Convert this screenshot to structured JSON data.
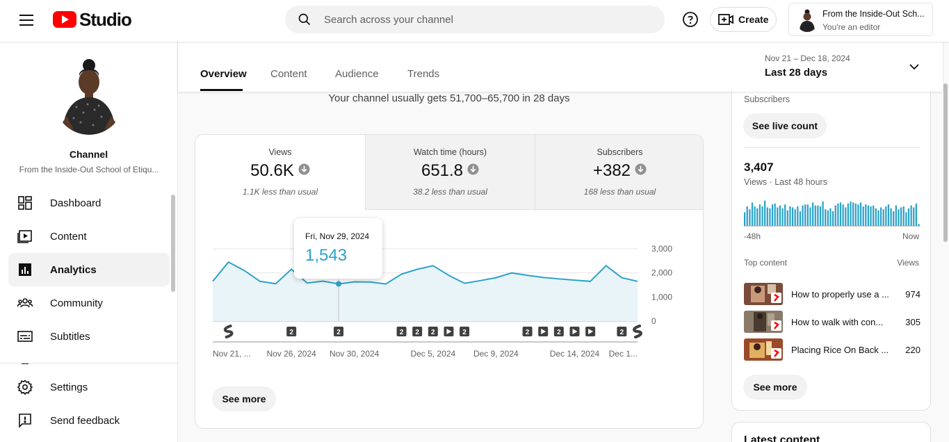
{
  "topbar": {
    "logo_text": "Studio",
    "search_placeholder": "Search across your channel",
    "create_label": "Create",
    "account_name": "From the Inside-Out Sch...",
    "account_role": "You're an editor"
  },
  "sidebar": {
    "channel_label": "Channel",
    "channel_name": "From the Inside-Out School of Etiqu...",
    "items": [
      {
        "label": "Dashboard",
        "icon": "dashboard-icon"
      },
      {
        "label": "Content",
        "icon": "content-icon"
      },
      {
        "label": "Analytics",
        "icon": "analytics-icon"
      },
      {
        "label": "Community",
        "icon": "community-icon"
      },
      {
        "label": "Subtitles",
        "icon": "subtitles-icon"
      }
    ],
    "bottom_items": [
      {
        "label": "Settings",
        "icon": "gear-icon"
      },
      {
        "label": "Send feedback",
        "icon": "feedback-icon"
      }
    ]
  },
  "tabs": [
    "Overview",
    "Content",
    "Audience",
    "Trends"
  ],
  "date_range": {
    "dates": "Nov 21 – Dec 18, 2024",
    "label": "Last 28 days"
  },
  "usual_text": "Your channel usually gets 51,700–65,700 in 28 days",
  "metrics": [
    {
      "label": "Views",
      "value": "50.6K",
      "comparison": "1.1K less than usual"
    },
    {
      "label": "Watch time (hours)",
      "value": "651.8",
      "comparison": "38.2 less than usual"
    },
    {
      "label": "Subscribers",
      "value": "+382",
      "comparison": "168 less than usual"
    }
  ],
  "chart_data": {
    "type": "area",
    "series_name": "Views",
    "x": [
      "Nov 21",
      "Nov 22",
      "Nov 23",
      "Nov 24",
      "Nov 25",
      "Nov 26",
      "Nov 27",
      "Nov 28",
      "Nov 29",
      "Nov 30",
      "Dec 1",
      "Dec 2",
      "Dec 3",
      "Dec 4",
      "Dec 5",
      "Dec 6",
      "Dec 7",
      "Dec 8",
      "Dec 9",
      "Dec 10",
      "Dec 11",
      "Dec 12",
      "Dec 13",
      "Dec 14",
      "Dec 15",
      "Dec 16",
      "Dec 17",
      "Dec 18"
    ],
    "values": [
      1650,
      2450,
      2100,
      1650,
      1550,
      2150,
      1580,
      1660,
      1543,
      1630,
      1620,
      1540,
      1950,
      2150,
      2300,
      1900,
      1570,
      1680,
      1800,
      2000,
      1900,
      1810,
      1750,
      1700,
      1650,
      2300,
      1800,
      1650
    ],
    "ylim": [
      0,
      3000
    ],
    "yticks": [
      "3,000",
      "2,000",
      "1,000",
      "0"
    ],
    "ytick_values": [
      3000,
      2000,
      1000,
      0
    ],
    "xtick_labels": [
      "Nov 21, ...",
      "Nov 26, 2024",
      "Nov 30, 2024",
      "Dec 5, 2024",
      "Dec 9, 2024",
      "Dec 14, 2024",
      "Dec 1..."
    ],
    "xtick_index": [
      0,
      5,
      9,
      14,
      18,
      23,
      27
    ],
    "markers": [
      {
        "index": 1,
        "kind": "short"
      },
      {
        "index": 5,
        "kind": "num",
        "text": "2"
      },
      {
        "index": 8,
        "kind": "num",
        "text": "2"
      },
      {
        "index": 12,
        "kind": "num",
        "text": "2"
      },
      {
        "index": 13,
        "kind": "num",
        "text": "2"
      },
      {
        "index": 14,
        "kind": "num",
        "text": "2"
      },
      {
        "index": 15,
        "kind": "video"
      },
      {
        "index": 16,
        "kind": "num",
        "text": "2"
      },
      {
        "index": 20,
        "kind": "num",
        "text": "2"
      },
      {
        "index": 21,
        "kind": "video"
      },
      {
        "index": 22,
        "kind": "num",
        "text": "2"
      },
      {
        "index": 23,
        "kind": "video"
      },
      {
        "index": 24,
        "kind": "video"
      },
      {
        "index": 26,
        "kind": "num",
        "text": "2"
      },
      {
        "index": 27,
        "kind": "short"
      },
      {
        "index": 28,
        "kind": "short"
      }
    ],
    "highlight_index": 8,
    "grid": true,
    "color": "#2ba2c9"
  },
  "tooltip": {
    "date": "Fri, Nov 29, 2024",
    "value": "1,543"
  },
  "see_more_label": "See more",
  "realtime": {
    "subscribers_label": "Subscribers",
    "live_count_label": "See live count",
    "views_value": "3,407",
    "views_label": "Views · Last 48 hours",
    "axis_left": "-48h",
    "axis_right": "Now",
    "bars": [
      14,
      20,
      17,
      24,
      20,
      18,
      22,
      20,
      26,
      19,
      18,
      22,
      23,
      19,
      21,
      18,
      22,
      16,
      20,
      19,
      17,
      20,
      15,
      21,
      22,
      22,
      19,
      24,
      21,
      21,
      20,
      25,
      17,
      16,
      18,
      15,
      21,
      23,
      24,
      22,
      19,
      23,
      25,
      24,
      23,
      22,
      24,
      20,
      22,
      21,
      20,
      21,
      18,
      16,
      19,
      17,
      20,
      22,
      18,
      15,
      21,
      17,
      19,
      20,
      14,
      18,
      21,
      19,
      23,
      2
    ],
    "top_content_label": "Top content",
    "views_col_label": "Views",
    "top_content": [
      {
        "title": "How to properly use a ...",
        "views": "974"
      },
      {
        "title": "How to walk with con...",
        "views": "305"
      },
      {
        "title": "Placing Rice On Back ...",
        "views": "220"
      }
    ],
    "see_more_label": "See more"
  },
  "latest_content_label": "Latest content"
}
